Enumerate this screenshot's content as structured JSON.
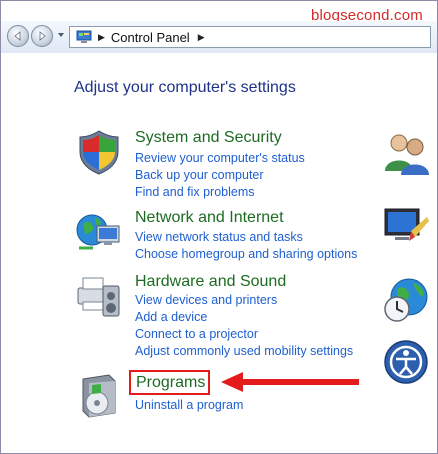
{
  "watermark": "blogsecond.com",
  "address_bar": {
    "location": "Control Panel",
    "icon": "control-panel-icon"
  },
  "heading": "Adjust your computer's settings",
  "categories": [
    {
      "title": "System and Security",
      "icon": "shield-icon",
      "links": [
        "Review your computer's status",
        "Back up your computer",
        "Find and fix problems"
      ]
    },
    {
      "title": "Network and Internet",
      "icon": "network-globe-icon",
      "links": [
        "View network status and tasks",
        "Choose homegroup and sharing options"
      ]
    },
    {
      "title": "Hardware and Sound",
      "icon": "printer-speaker-icon",
      "links": [
        "View devices and printers",
        "Add a device",
        "Connect to a projector",
        "Adjust commonly used mobility settings"
      ]
    },
    {
      "title": "Programs",
      "icon": "programs-box-icon",
      "links": [
        "Uninstall a program"
      ]
    }
  ],
  "right_icons": [
    "user-accounts-icon",
    "appearance-icon",
    "clock-globe-icon",
    "ease-of-access-icon"
  ],
  "colors": {
    "heading": "#1e3287",
    "category_title": "#1d6b22",
    "link": "#1e5fd1",
    "annotation": "#e41b1b"
  }
}
